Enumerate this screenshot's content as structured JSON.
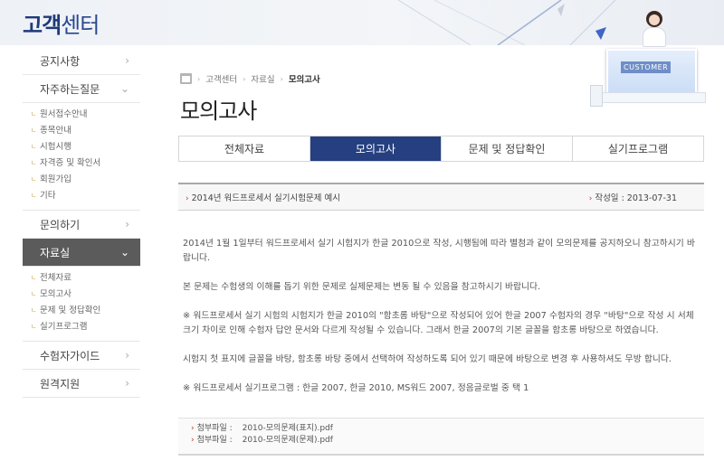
{
  "header": {
    "brand_bold": "고객",
    "brand_light": "센터",
    "illustration_label": "CUSTOMER"
  },
  "sidebar": {
    "items": [
      {
        "label": "공지사항"
      },
      {
        "label": "자주하는질문"
      },
      {
        "label": "문의하기"
      },
      {
        "label": "자료실"
      },
      {
        "label": "수험자가이드"
      },
      {
        "label": "원격지원"
      }
    ],
    "faq_sub": [
      "원서접수안내",
      "종목안내",
      "시험시행",
      "자격증 및 확인서",
      "회원가입",
      "기타"
    ],
    "archive_sub": [
      "전체자료",
      "모의고사",
      "문제 및 정답확인",
      "실기프로그램"
    ]
  },
  "breadcrumb": {
    "items": [
      "고객센터",
      "자료실",
      "모의고사"
    ]
  },
  "page_title": "모의고사",
  "tabs": [
    {
      "label": "전체자료"
    },
    {
      "label": "모의고사"
    },
    {
      "label": "문제 및 정답확인"
    },
    {
      "label": "실기프로그램"
    }
  ],
  "post": {
    "title": "2014년 워드프로세서 실기시험문제 예시",
    "date": "작성일 : 2013-07-31",
    "paragraphs": [
      "2014년 1월 1일부터 워드프로세서 실기 시험지가 한글 2010으로 작성, 시행됨에 따라 별첨과 같이 모의문제를 공지하오니 참고하시기 바랍니다.",
      "본 문제는 수험생의 이해를 돕기 위한 문제로 실제문제는 변동 될 수 있음을 참고하시기 바랍니다.",
      "※ 워드프로세서 실기 시험의 시험지가 한글 2010의 \"함초롬 바탕\"으로 작성되어 있어 한글 2007 수험자의 경우 \"바탕\"으로 작성 시 서체 크기 차이로 인해 수험자 답안 문서와 다르게 작성될 수 있습니다. 그래서 한글 2007의 기본 글꼴을 함초롱 바탕으로 하였습니다.",
      "시험지 첫 표지에 글꼴을 바탕, 함초롱 바탕 중에서 선택하여 작성하도록 되어 있기 때문에 바탕으로 변경 후 사용하셔도 무방 합니다.",
      "※ 워드프로세서 실기프로그램 : 한글 2007, 한글 2010, MS워드 2007, 정음글로벌 중 택 1"
    ],
    "attachments": [
      {
        "label": "첨부파일 :",
        "name": "2010-모의문제(표지).pdf"
      },
      {
        "label": "첨부파일 :",
        "name": "2010-모의문제(문제).pdf"
      }
    ]
  }
}
